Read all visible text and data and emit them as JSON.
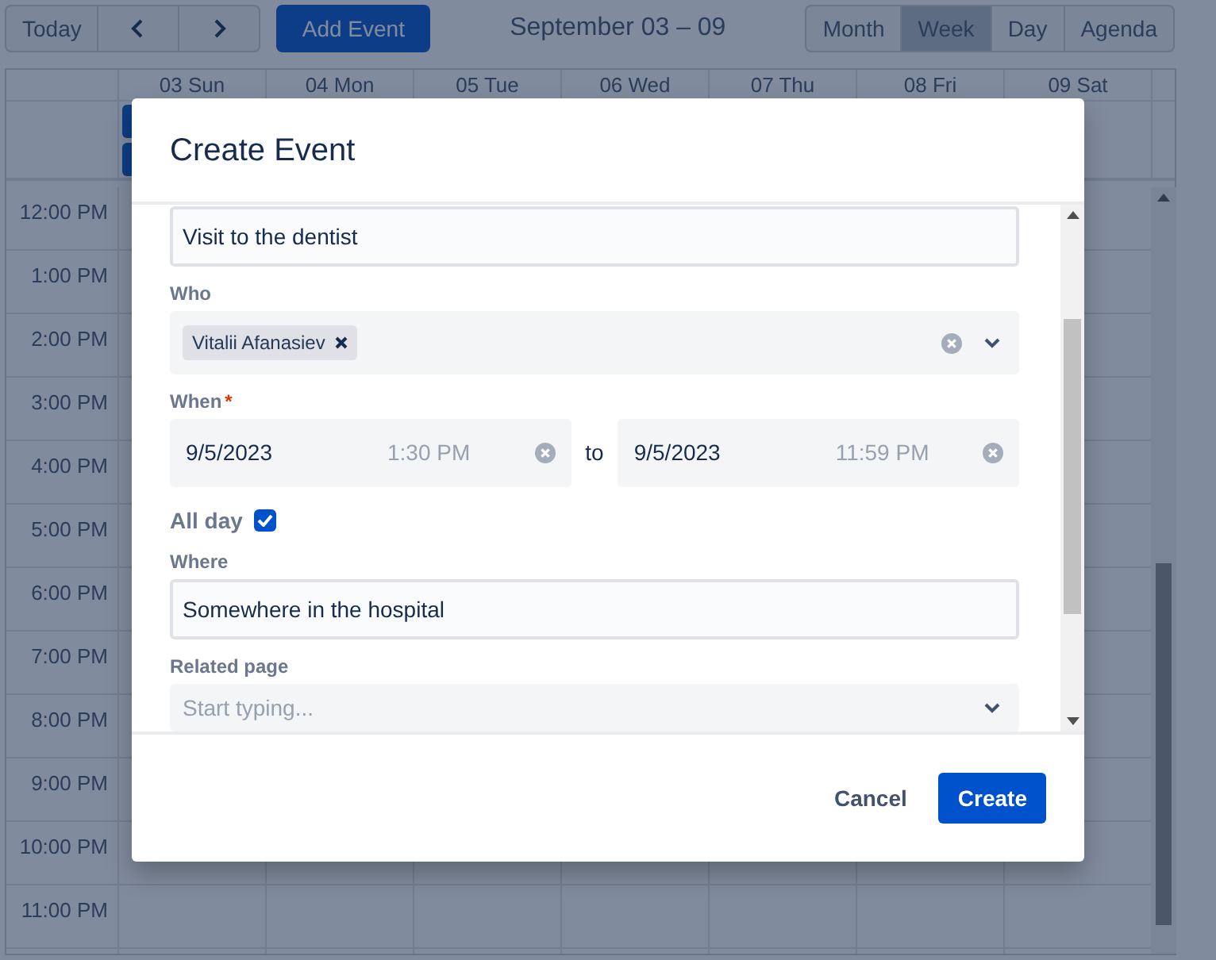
{
  "toolbar": {
    "today": "Today",
    "add_button": "Add Event",
    "title": "September 03 – 09",
    "views": [
      {
        "label": "Month",
        "selected": false
      },
      {
        "label": "Week",
        "selected": true
      },
      {
        "label": "Day",
        "selected": false
      },
      {
        "label": "Agenda",
        "selected": false
      }
    ]
  },
  "calendar": {
    "days": [
      "03 Sun",
      "04 Mon",
      "05 Tue",
      "06 Wed",
      "07 Thu",
      "08 Fri",
      "09 Sat"
    ],
    "hours": [
      "12:00 PM",
      "1:00 PM",
      "2:00 PM",
      "3:00 PM",
      "4:00 PM",
      "5:00 PM",
      "6:00 PM",
      "7:00 PM",
      "8:00 PM",
      "9:00 PM",
      "10:00 PM",
      "11:00 PM"
    ]
  },
  "dialog": {
    "title": "Create Event",
    "fields": [
      {
        "kind": "text",
        "value": "Visit to the dentist"
      },
      {
        "kind": "tags",
        "label": "Who",
        "tags": [
          "Vitalii Afanasiev"
        ]
      },
      {
        "kind": "range",
        "label": "When",
        "required_mark": "*",
        "start": {
          "date": "9/5/2023",
          "time": "1:30 PM"
        },
        "separator": "to",
        "end": {
          "date": "9/5/2023",
          "time": "11:59 PM"
        },
        "time_disabled": true
      },
      {
        "kind": "checkbox",
        "label": "All day",
        "checked": true
      },
      {
        "kind": "text",
        "label": "Where",
        "value": "Somewhere in the hospital"
      },
      {
        "kind": "select",
        "label": "Related page",
        "placeholder": "Start typing..."
      }
    ],
    "buttons": [
      {
        "label": "Cancel",
        "kind": "secondary"
      },
      {
        "label": "Create",
        "kind": "primary"
      }
    ]
  }
}
